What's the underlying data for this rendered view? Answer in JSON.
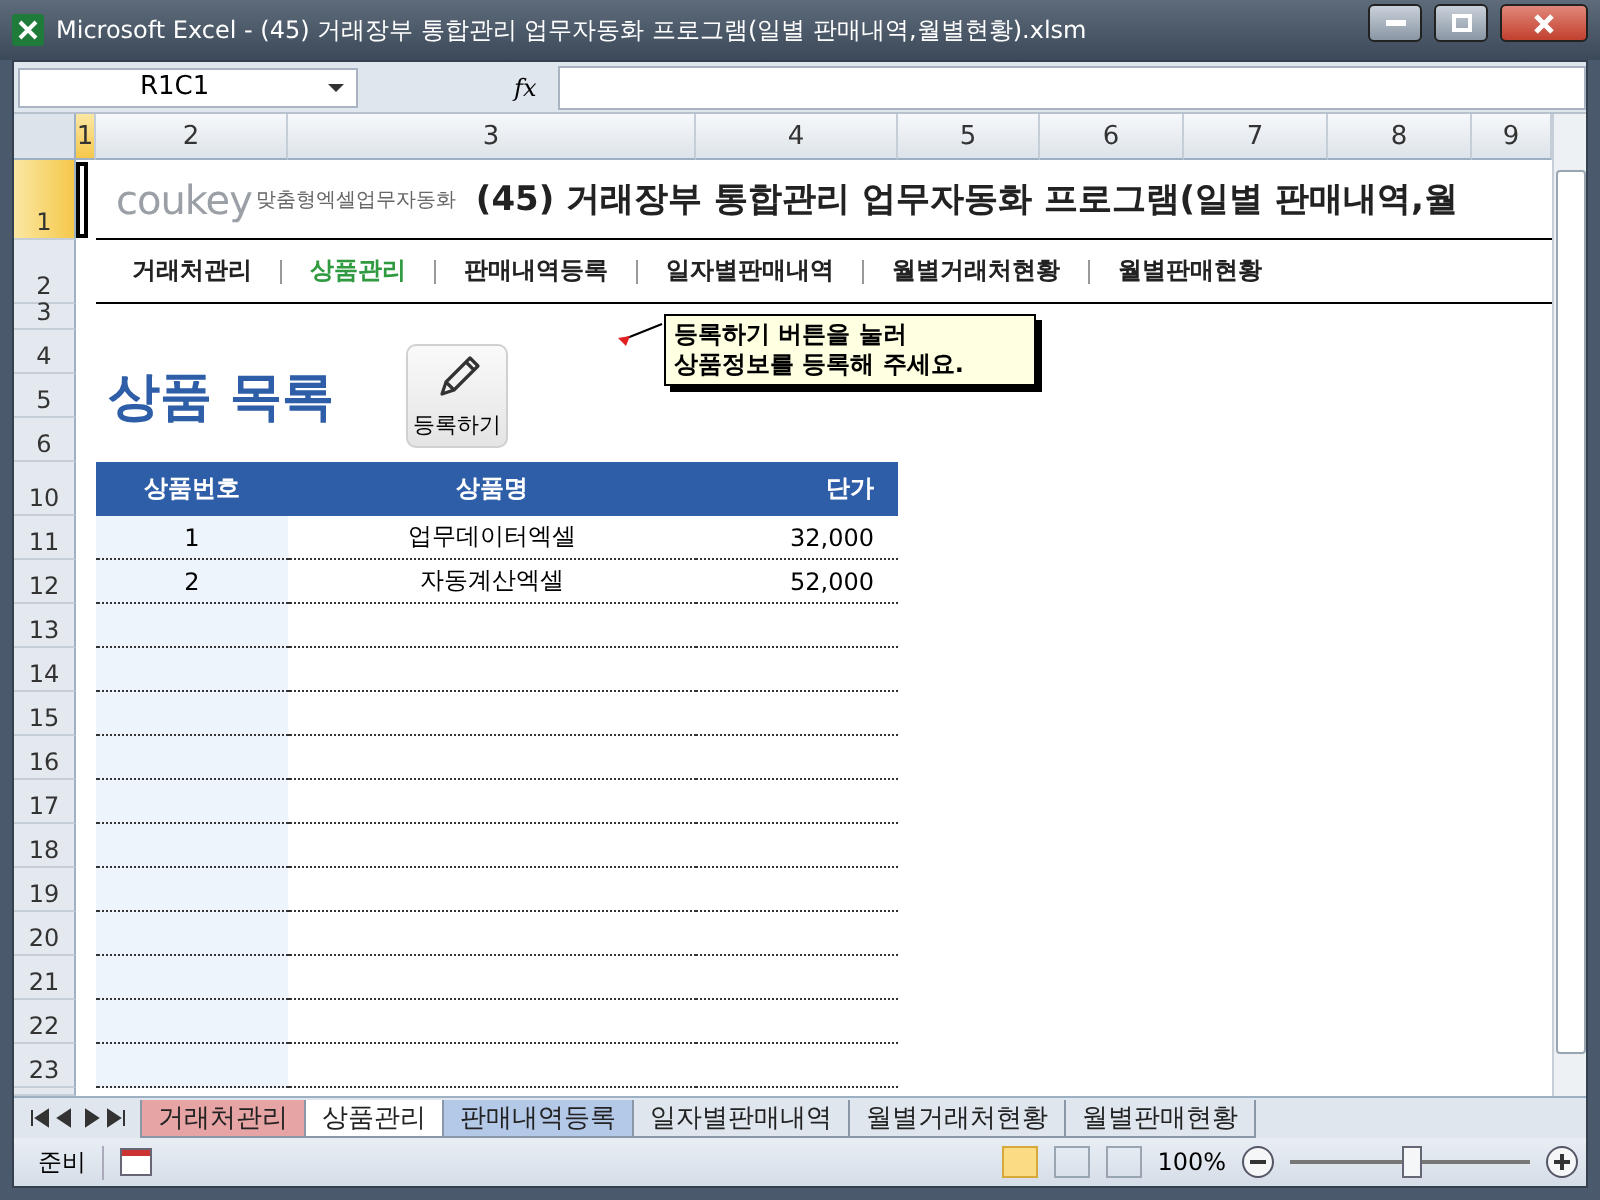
{
  "window": {
    "title": "Microsoft Excel - (45) 거래장부 통합관리 업무자동화 프로그램(일별 판매내역,월별현황).xlsm"
  },
  "formula_bar": {
    "name_box": "R1C1",
    "fx": "fx"
  },
  "column_headers": [
    {
      "label": "1",
      "selected": true
    },
    {
      "label": "2",
      "selected": false
    },
    {
      "label": "3",
      "selected": false
    },
    {
      "label": "4",
      "selected": false
    },
    {
      "label": "5",
      "selected": false
    },
    {
      "label": "6",
      "selected": false
    },
    {
      "label": "7",
      "selected": false
    },
    {
      "label": "8",
      "selected": false
    },
    {
      "label": "9",
      "selected": false
    }
  ],
  "row_headers": [
    {
      "label": "1",
      "selected": true
    },
    {
      "label": "2",
      "selected": false
    },
    {
      "label": "3",
      "selected": false
    },
    {
      "label": "4",
      "selected": false
    },
    {
      "label": "5",
      "selected": false
    },
    {
      "label": "6",
      "selected": false
    },
    {
      "label": "10",
      "selected": false
    },
    {
      "label": "11",
      "selected": false
    },
    {
      "label": "12",
      "selected": false
    },
    {
      "label": "13",
      "selected": false
    },
    {
      "label": "14",
      "selected": false
    },
    {
      "label": "15",
      "selected": false
    },
    {
      "label": "16",
      "selected": false
    },
    {
      "label": "17",
      "selected": false
    },
    {
      "label": "18",
      "selected": false
    },
    {
      "label": "19",
      "selected": false
    },
    {
      "label": "20",
      "selected": false
    },
    {
      "label": "21",
      "selected": false
    },
    {
      "label": "22",
      "selected": false
    },
    {
      "label": "23",
      "selected": false
    }
  ],
  "banner": {
    "logo": "coukey",
    "logo_tagline": "맞춤형엑셀업무자동화",
    "title": "(45) 거래장부 통합관리 업무자동화 프로그램(일별 판매내역,월"
  },
  "nav": [
    {
      "label": "거래처관리",
      "selected": false
    },
    {
      "label": "상품관리",
      "selected": true
    },
    {
      "label": "판매내역등록",
      "selected": false
    },
    {
      "label": "일자별판매내역",
      "selected": false
    },
    {
      "label": "월별거래처현황",
      "selected": false
    },
    {
      "label": "월별판매현황",
      "selected": false
    }
  ],
  "heading": "상품 목록",
  "register_button": "등록하기",
  "note": [
    "등록하기 버튼을 눌러",
    "상품정보를 등록해 주세요."
  ],
  "table": {
    "columns": [
      "상품번호",
      "상품명",
      "단가"
    ],
    "rows": [
      [
        "1",
        "업무데이터엑셀",
        "32,000"
      ],
      [
        "2",
        "자동계산엑셀",
        "52,000"
      ]
    ]
  },
  "sheet_tabs": [
    {
      "label": "거래처관리",
      "selected": false,
      "color": "#e6a4a4"
    },
    {
      "label": "상품관리",
      "selected": true
    },
    {
      "label": "판매내역등록",
      "selected": false,
      "color": "#b4c8e8"
    },
    {
      "label": "일자별판매내역",
      "selected": false
    },
    {
      "label": "월별거래처현황",
      "selected": false
    },
    {
      "label": "월별판매현황",
      "selected": false
    }
  ],
  "status_bar": {
    "status": "준비",
    "zoom": "100%",
    "level": 0.5
  }
}
